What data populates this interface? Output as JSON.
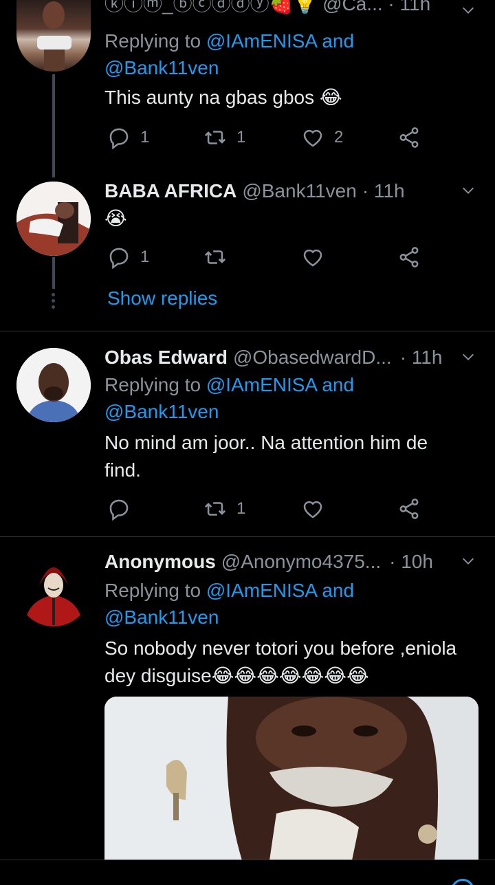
{
  "tweets": [
    {
      "top_partial": "ⓚⓘⓜ_ⓑⓒⓓⓓⓨ🍓💡 @Ca...  · 11h",
      "replying_prefix": "Replying to",
      "replying_user1": "@IAmENISA",
      "replying_and": "and",
      "replying_user2": "@Bank11ven",
      "text": "This aunty na gbas gbos 😂",
      "reply_count": "1",
      "retweet_count": "1",
      "like_count": "2"
    },
    {
      "name": "BABA AFRICA",
      "handle": "@Bank11ven",
      "time": "· 11h",
      "text": "😭",
      "reply_count": "1",
      "show_replies": "Show replies"
    },
    {
      "name": "Obas Edward",
      "handle": "@ObasedwardD...",
      "time": "· 11h",
      "replying_prefix": "Replying to",
      "replying_user1": "@IAmENISA",
      "replying_and": "and",
      "replying_user2": "@Bank11ven",
      "text": "No mind am joor.. Na attention him de find.",
      "retweet_count": "1"
    },
    {
      "name": "Anonymous",
      "handle": "@Anonymo4375...",
      "time": "· 10h",
      "replying_prefix": "Replying to",
      "replying_user1": "@IAmENISA",
      "replying_and": "and",
      "replying_user2": "@Bank11ven",
      "text": "So nobody never totori you before ,eniola dey disguise😂😂😂😂😂😂😂"
    }
  ],
  "icons": {
    "reply": "reply-icon",
    "retweet": "retweet-icon",
    "like": "heart-icon",
    "share": "share-icon",
    "more": "chevron-down-icon"
  },
  "colors": {
    "background": "#000000",
    "link": "#1d9bf0",
    "secondary_text": "#8a939c",
    "primary_text": "#e7e9ea"
  }
}
